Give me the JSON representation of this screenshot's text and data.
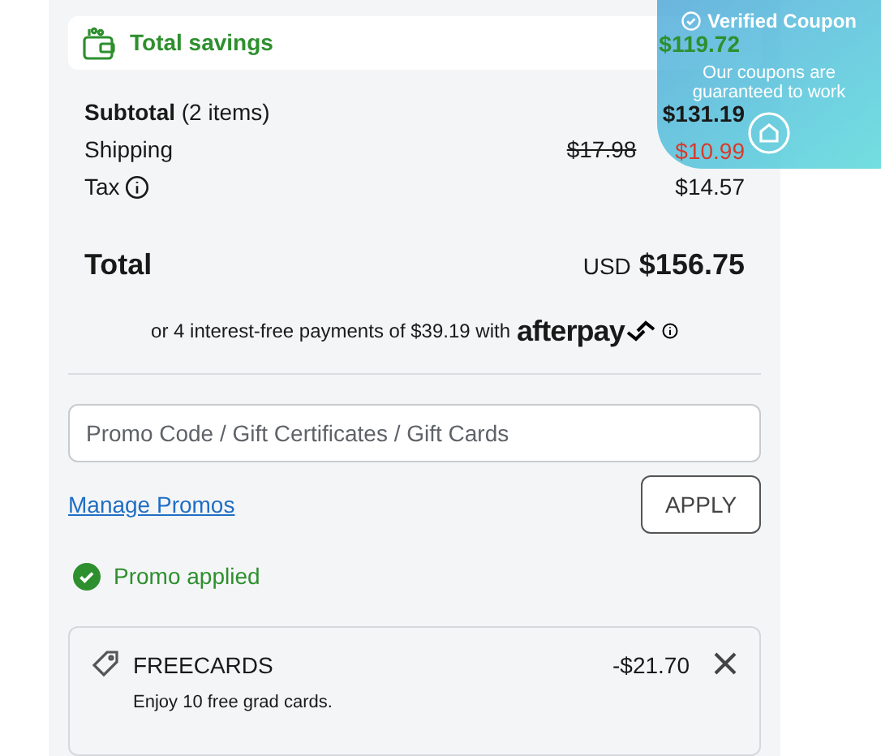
{
  "savings": {
    "label": "Total savings",
    "amount": "$119.72"
  },
  "summary": {
    "subtotal": {
      "label": "Subtotal",
      "count": "(2 items)",
      "amount": "$131.19"
    },
    "shipping": {
      "label": "Shipping",
      "original": "$17.98",
      "amount": "$10.99"
    },
    "tax": {
      "label": "Tax",
      "amount": "$14.57"
    }
  },
  "total": {
    "label": "Total",
    "currency": "USD",
    "amount": "$156.75"
  },
  "installments": {
    "text": "or 4 interest-free payments of $39.19 with",
    "brand": "afterpay"
  },
  "promo_field": {
    "placeholder": "Promo Code / Gift Certificates / Gift Cards"
  },
  "manage_link": "Manage Promos",
  "apply_button": "APPLY",
  "promo_status": "Promo applied",
  "applied_promos": [
    {
      "code": "FREECARDS",
      "description": "Enjoy 10 free grad cards.",
      "amount": "-$21.70"
    }
  ],
  "coupon_overlay": {
    "title": "Verified Coupon",
    "text": "Our coupons are guaranteed to work"
  }
}
